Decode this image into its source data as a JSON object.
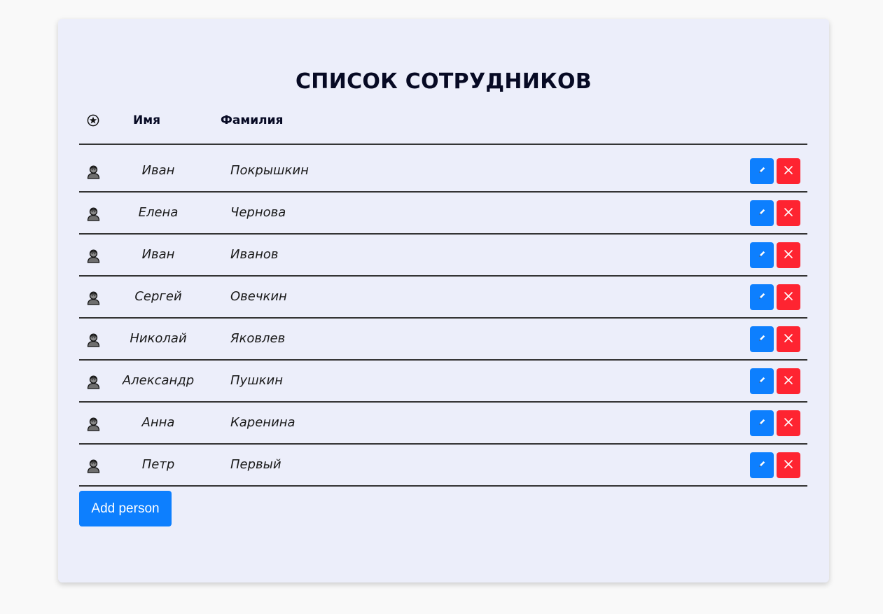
{
  "title": "СПИСОК СОТРУДНИКОВ",
  "table": {
    "header_icon": "star-icon",
    "col_first": "Имя",
    "col_last": "Фамилия",
    "row_icon": "person-icon",
    "edit_icon": "pencil-icon",
    "delete_icon": "close-icon",
    "rows": [
      {
        "first": "Иван",
        "last": "Покрышкин"
      },
      {
        "first": "Елена",
        "last": "Чернова"
      },
      {
        "first": "Иван",
        "last": "Иванов"
      },
      {
        "first": "Сергей",
        "last": "Овечкин"
      },
      {
        "first": "Николай",
        "last": "Яковлев"
      },
      {
        "first": "Александр",
        "last": "Пушкин"
      },
      {
        "first": "Анна",
        "last": "Каренина"
      },
      {
        "first": "Петр",
        "last": "Первый"
      }
    ]
  },
  "add_button": "Add person",
  "colors": {
    "primary": "#0d7ffe",
    "danger": "#fe2431",
    "card_bg": "#eceefa",
    "page_bg": "#f9f9f9"
  }
}
